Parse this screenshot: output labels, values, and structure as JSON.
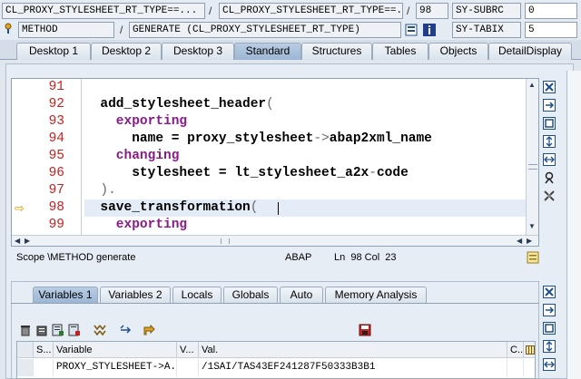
{
  "header": {
    "row1": {
      "left_field": "CL_PROXY_STYLESHEET_RT_TYPE==...",
      "sep1": "/",
      "mid_field": "CL_PROXY_STYLESHEET_RT_TYPE==...",
      "sep2": "/",
      "line_field": "98",
      "sys_label": "SY-SUBRC",
      "sys_value": "0"
    },
    "row2": {
      "left_field": "METHOD",
      "sep1": "/",
      "mid_field": "GENERATE (CL_PROXY_STYLESHEET_RT_TYPE)",
      "sys_label": "SY-TABIX",
      "sys_value": "5"
    }
  },
  "tabs": [
    {
      "label": "Desktop 1"
    },
    {
      "label": "Desktop 2"
    },
    {
      "label": "Desktop 3"
    },
    {
      "label": "Standard"
    },
    {
      "label": "Structures"
    },
    {
      "label": "Tables"
    },
    {
      "label": "Objects"
    },
    {
      "label": "DetailDisplay"
    }
  ],
  "editor": {
    "line_numbers": [
      "91",
      "92",
      "93",
      "94",
      "95",
      "96",
      "97",
      "98",
      "99"
    ],
    "lines": [
      {
        "parts": [
          {
            "t": "",
            "c": "n"
          }
        ]
      },
      {
        "parts": [
          {
            "t": "  add_stylesheet_header",
            "c": "n"
          },
          {
            "t": "(",
            "c": "s"
          }
        ]
      },
      {
        "parts": [
          {
            "t": "    exporting",
            "c": "k"
          }
        ]
      },
      {
        "parts": [
          {
            "t": "      name = proxy_stylesheet",
            "c": "n"
          },
          {
            "t": "->",
            "c": "s"
          },
          {
            "t": "abap2xml_name",
            "c": "n"
          }
        ]
      },
      {
        "parts": [
          {
            "t": "    changing",
            "c": "k"
          }
        ]
      },
      {
        "parts": [
          {
            "t": "      stylesheet = lt_stylesheet_a2x",
            "c": "n"
          },
          {
            "t": "-",
            "c": "s"
          },
          {
            "t": "code",
            "c": "n"
          }
        ]
      },
      {
        "parts": [
          {
            "t": "  ).",
            "c": "s"
          }
        ]
      },
      {
        "parts": [
          {
            "t": "  save_transformation",
            "c": "n"
          },
          {
            "t": "(",
            "c": "s"
          }
        ]
      },
      {
        "parts": [
          {
            "t": "    exporting",
            "c": "k"
          }
        ]
      }
    ],
    "current_line_marker": "⇨"
  },
  "status": {
    "scope": "Scope \\METHOD generate",
    "lang": "ABAP",
    "position": "Ln  98 Col  23"
  },
  "lower": {
    "tabs": [
      {
        "label": "Variables 1"
      },
      {
        "label": "Variables 2"
      },
      {
        "label": "Locals"
      },
      {
        "label": "Globals"
      },
      {
        "label": "Auto"
      },
      {
        "label": "Memory Analysis"
      }
    ],
    "table": {
      "headers": [
        "S...",
        "Variable",
        "V...",
        "Val.",
        "C..."
      ],
      "row": [
        "",
        "PROXY_STYLESHEET->A...",
        "",
        "/1SAI/TAS43EF241287F50333B3B1",
        ""
      ]
    }
  },
  "colors": {
    "keyword": "#8a1a8a",
    "line_number": "#c42222",
    "active_tab": "#9bb6d4"
  }
}
